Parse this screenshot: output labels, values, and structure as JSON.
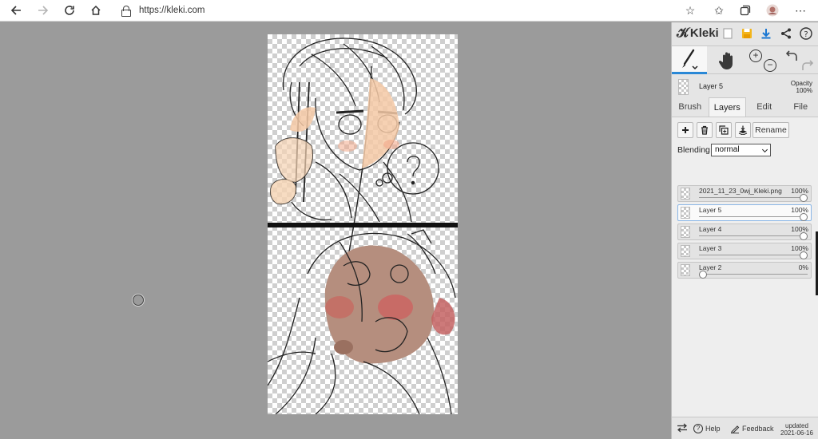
{
  "browser": {
    "url": "https://kleki.com",
    "back_icon": "arrow-left-icon",
    "forward_icon": "arrow-right-icon",
    "reload_icon": "reload-icon",
    "home_icon": "home-icon"
  },
  "app": {
    "logo_text": "Kleki"
  },
  "layer_header": {
    "name": "Layer 5",
    "opacity_label": "Opacity",
    "opacity_value": "100%"
  },
  "tabs": [
    {
      "label": "Brush",
      "active": false
    },
    {
      "label": "Layers",
      "active": true
    },
    {
      "label": "Edit",
      "active": false
    },
    {
      "label": "File",
      "active": false
    }
  ],
  "layer_toolbar": {
    "rename_label": "Rename"
  },
  "blending": {
    "label": "Blending",
    "value": "normal"
  },
  "layers": [
    {
      "name": "2021_11_23_0wj_Kleki.png",
      "opacity": "100%",
      "level": 1.0,
      "selected": false
    },
    {
      "name": "Layer 5",
      "opacity": "100%",
      "level": 1.0,
      "selected": true
    },
    {
      "name": "Layer 4",
      "opacity": "100%",
      "level": 1.0,
      "selected": false
    },
    {
      "name": "Layer 3",
      "opacity": "100%",
      "level": 1.0,
      "selected": false
    },
    {
      "name": "Layer 2",
      "opacity": "0%",
      "level": 0.0,
      "selected": false
    }
  ],
  "footer": {
    "help_label": "Help",
    "feedback_label": "Feedback",
    "updated_label": "updated",
    "updated_date": "2021-06-16"
  },
  "colors": {
    "accent": "#2a88d6",
    "canvas_bg": "#9b9b9b",
    "panel_bg": "#e5e5e5"
  }
}
